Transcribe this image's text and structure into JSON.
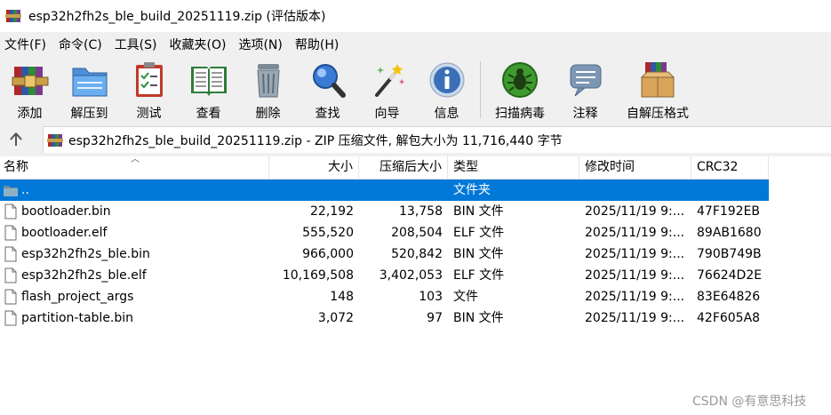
{
  "window": {
    "title": "esp32h2fh2s_ble_build_20251119.zip (评估版本)",
    "icon": "winrar-books-icon"
  },
  "menu": [
    "文件(F)",
    "命令(C)",
    "工具(S)",
    "收藏夹(O)",
    "选项(N)",
    "帮助(H)"
  ],
  "toolbar": {
    "add": "添加",
    "extract": "解压到",
    "test": "测试",
    "view": "查看",
    "delete": "删除",
    "find": "查找",
    "wizard": "向导",
    "info": "信息",
    "scan": "扫描病毒",
    "comment": "注释",
    "sfx": "自解压格式"
  },
  "address": {
    "up_icon": "up-arrow-icon",
    "text": "esp32h2fh2s_ble_build_20251119.zip - ZIP 压缩文件, 解包大小为 11,716,440 字节"
  },
  "columns": {
    "name": "名称",
    "size": "大小",
    "packed": "压缩后大小",
    "type": "类型",
    "modified": "修改时间",
    "crc": "CRC32"
  },
  "files": [
    {
      "name": "..",
      "size": "",
      "packed": "",
      "type": "文件夹",
      "modified": "",
      "crc": "",
      "icon": "folder-icon",
      "selected": true
    },
    {
      "name": "bootloader.bin",
      "size": "22,192",
      "packed": "13,758",
      "type": "BIN 文件",
      "modified": "2025/11/19 9:...",
      "crc": "47F192EB",
      "icon": "file-icon"
    },
    {
      "name": "bootloader.elf",
      "size": "555,520",
      "packed": "208,504",
      "type": "ELF 文件",
      "modified": "2025/11/19 9:...",
      "crc": "89AB1680",
      "icon": "file-icon"
    },
    {
      "name": "esp32h2fh2s_ble.bin",
      "size": "966,000",
      "packed": "520,842",
      "type": "BIN 文件",
      "modified": "2025/11/19 9:...",
      "crc": "790B749B",
      "icon": "file-icon"
    },
    {
      "name": "esp32h2fh2s_ble.elf",
      "size": "10,169,508",
      "packed": "3,402,053",
      "type": "ELF 文件",
      "modified": "2025/11/19 9:...",
      "crc": "76624D2E",
      "icon": "file-icon"
    },
    {
      "name": "flash_project_args",
      "size": "148",
      "packed": "103",
      "type": "文件",
      "modified": "2025/11/19 9:...",
      "crc": "83E64826",
      "icon": "file-icon"
    },
    {
      "name": "partition-table.bin",
      "size": "3,072",
      "packed": "97",
      "type": "BIN 文件",
      "modified": "2025/11/19 9:...",
      "crc": "42F605A8",
      "icon": "file-icon"
    }
  ],
  "colors": {
    "selection": "#0078d7",
    "background": "#ffffff",
    "chrome": "#f0f0f0"
  },
  "watermark": "CSDN @有意思科技"
}
